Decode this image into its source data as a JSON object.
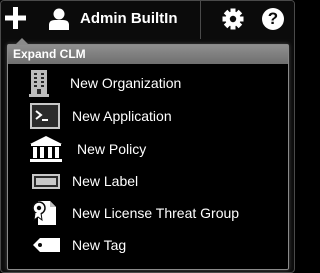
{
  "topbar": {
    "add_icon": "plus-icon",
    "user_icon": "user-icon",
    "user_name": "Admin BuiltIn",
    "settings_icon": "gear-icon",
    "help_label": "?"
  },
  "menu": {
    "header": "Expand CLM",
    "items": [
      {
        "label": "New Organization",
        "icon": "building-icon"
      },
      {
        "label": "New Application",
        "icon": "terminal-icon"
      },
      {
        "label": "New Policy",
        "icon": "courthouse-icon"
      },
      {
        "label": "New Label",
        "icon": "label-icon"
      },
      {
        "label": "New License Threat Group",
        "icon": "document-icon"
      },
      {
        "label": "New Tag",
        "icon": "tag-icon"
      }
    ]
  },
  "colors": {
    "background": "#000000",
    "header_bg": "#7f7f7f",
    "text": "#ffffff"
  }
}
